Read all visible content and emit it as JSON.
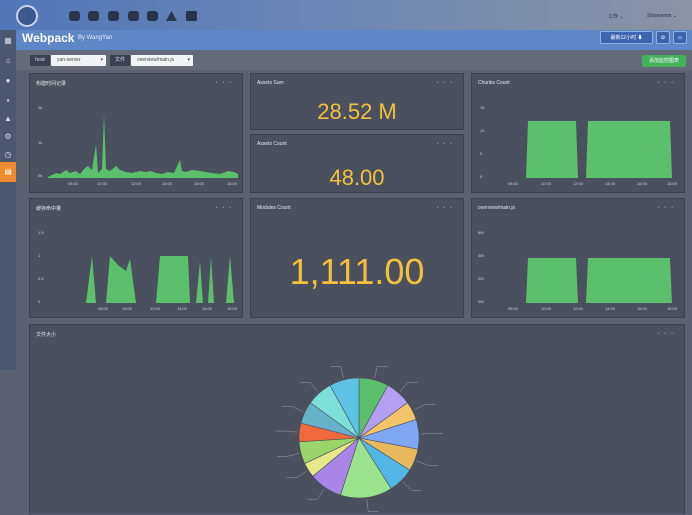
{
  "app": {
    "title": "Webpack",
    "byline": "By  WangYan",
    "user_menu_1": "工作 ⌄",
    "user_menu_2": "Shiwenmin ⌄"
  },
  "toolbar": {
    "icons": [
      "cloud-icon",
      "cloud-icon",
      "wifi-icon",
      "cloud-icon",
      "cloud-icon",
      "warning-icon",
      "grid-icon"
    ]
  },
  "header_buttons": {
    "time_range": "最新12小时 ⬇",
    "settings_icon": "⚙",
    "screen_icon": "▭"
  },
  "filters": {
    "host_label": "host",
    "host_value": "yan-server",
    "file_label": "文件",
    "file_value": "overview/main.js",
    "add_button": "添加监控图表"
  },
  "panels": {
    "build_time": {
      "title": "构建时间记录",
      "y_ticks": [
        "2k",
        "1k",
        "0k"
      ],
      "x_ticks": [
        "08:00",
        "10:00",
        "12:00",
        "14:00",
        "16:00",
        "18:00"
      ]
    },
    "assets_sum": {
      "title": "Assets Sum",
      "value": "28.52 M"
    },
    "assets_count": {
      "title": "Assets Count",
      "value": "48.00"
    },
    "chunks_count": {
      "title": "Chunks Count",
      "y_ticks": [
        "15",
        "10",
        "5",
        "0"
      ],
      "x_ticks": [
        "08:00",
        "10:00",
        "12:00",
        "14:00",
        "16:00",
        "18:00"
      ]
    },
    "cache_count": {
      "title": "缓存命中量",
      "y_ticks": [
        "1.5",
        "1",
        "0.5",
        "0"
      ],
      "x_ticks": [
        "08:00",
        "10:00",
        "12:00",
        "14:00",
        "16:00",
        "18:00"
      ]
    },
    "modules_count": {
      "title": "Modules Count",
      "value": "1,111.00"
    },
    "overview_main": {
      "title": "overview/main.js",
      "y_ticks": [
        "6M",
        "4M",
        "2M",
        "0M"
      ],
      "x_ticks": [
        "08:00",
        "10:00",
        "12:00",
        "14:00",
        "16:00",
        "18:00"
      ]
    },
    "file_size": {
      "title": "文件大小"
    }
  },
  "pie": {
    "colors": [
      "#5bbf6b",
      "#b49ef2",
      "#f3c46a",
      "#7ea7f2",
      "#e8b95c",
      "#52b7e6",
      "#9ae38c",
      "#a985e8",
      "#e6e88a",
      "#9bd46b",
      "#f16a3e",
      "#66b2c8",
      "#7de0d8",
      "#5cc2e6"
    ],
    "values": [
      8,
      7,
      5,
      8,
      6,
      7,
      14,
      9,
      4,
      6,
      5,
      6,
      7,
      8
    ]
  }
}
